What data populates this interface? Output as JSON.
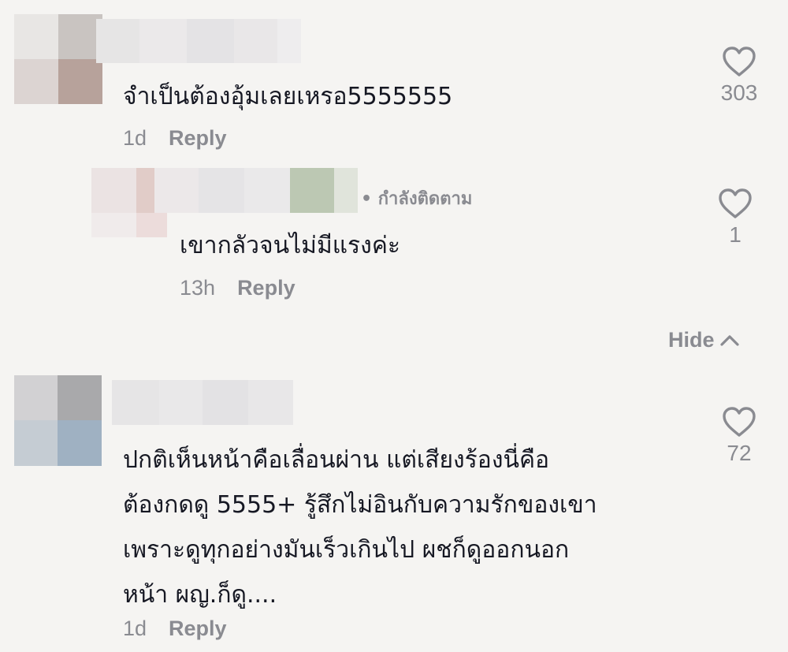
{
  "comments": [
    {
      "text": "จำเป็นต้องอุ้มเลยเหรอ5555555",
      "time": "1d",
      "reply_label": "Reply",
      "likes": "303"
    },
    {
      "badge": "• กำลังติดตาม",
      "text": "เขากลัวจนไม่มีแรงค่ะ",
      "time": "13h",
      "reply_label": "Reply",
      "likes": "1"
    },
    {
      "text_lines": [
        "ปกติเห็นหน้าคือเลื่อนผ่าน แต่เสียงร้องนี่คือ",
        "ต้องกดดู 5555+ รู้สึกไม่อินกับความรักของเขา",
        "เพราะดูทุกอย่างมันเร็วเกินไป ผชก็ดูออกนอก",
        "หน้า ผญ.ก็ดู...."
      ],
      "time": "1d",
      "reply_label": "Reply",
      "likes": "72"
    }
  ],
  "hide_label": "Hide",
  "icons": {
    "like": "heart-outline-icon",
    "hide": "chevron-up-icon"
  },
  "colors": {
    "background": "#f5f4f2",
    "text": "#161823",
    "muted": "#8a8b91"
  }
}
